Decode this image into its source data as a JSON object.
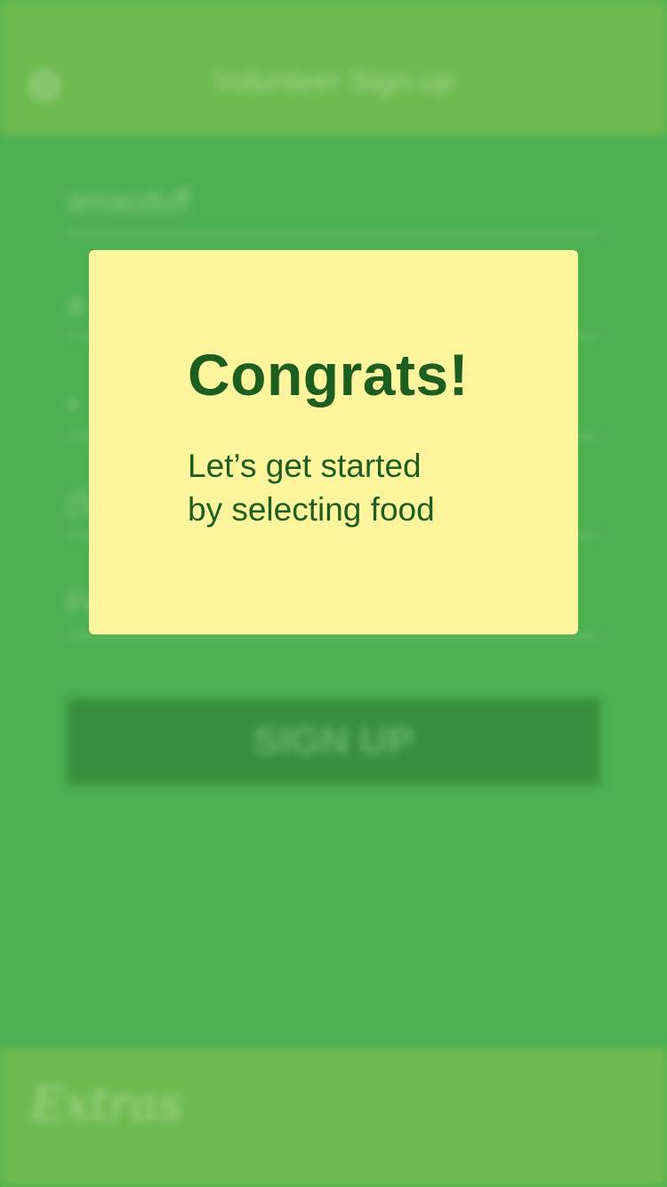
{
  "header": {
    "title": "Volunteer Sign-up",
    "settings_icon": "gear-icon"
  },
  "form": {
    "username_value": "amacduff",
    "email_value": "a",
    "password_value": "•",
    "phone_value": "(5",
    "food_value": "Fo",
    "signup_label": "SIGN UP"
  },
  "footer": {
    "brand": "Extras"
  },
  "modal": {
    "heading": "Congrats!",
    "line1": "Let’s get started",
    "line2": "by selecting food"
  },
  "colors": {
    "header_bg": "#6dba4f",
    "form_bg": "#4caf50",
    "button_bg": "#388e3c",
    "modal_bg": "#fff59d",
    "modal_text": "#1b5e20"
  }
}
